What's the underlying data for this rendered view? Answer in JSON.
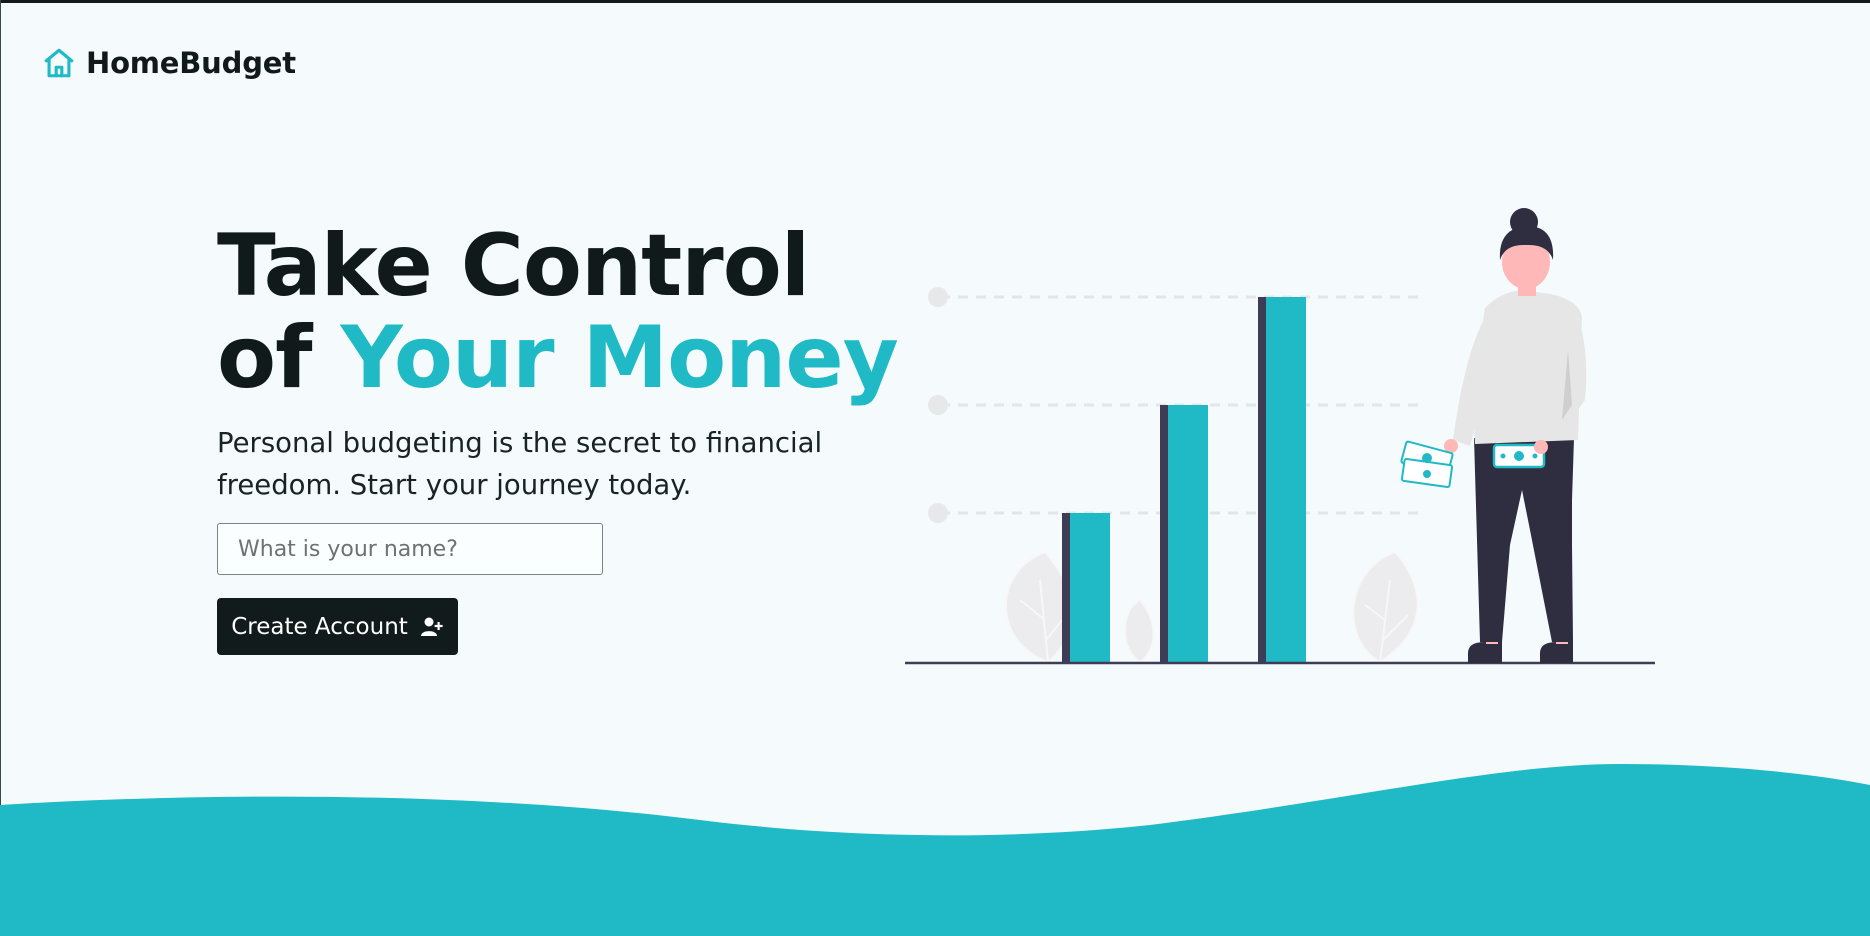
{
  "nav": {
    "brand": "HomeBudget",
    "icon": "home-icon"
  },
  "hero": {
    "title_line1": "Take Control",
    "title_line2_prefix": "of ",
    "title_line2_accent": "Your Money",
    "subtitle": "Personal budgeting is the secret to financial freedom. Start your journey today."
  },
  "form": {
    "name_placeholder": "What is your name?",
    "name_value": "",
    "submit_label": "Create Account",
    "submit_icon": "user-plus-icon"
  },
  "illustration": {
    "description_icon": "growth-chart-woman-illustration"
  },
  "colors": {
    "accent": "#1fbac6",
    "dark": "#121b1c",
    "background": "#f5fbfc",
    "chart_dark": "#3f3d56"
  }
}
